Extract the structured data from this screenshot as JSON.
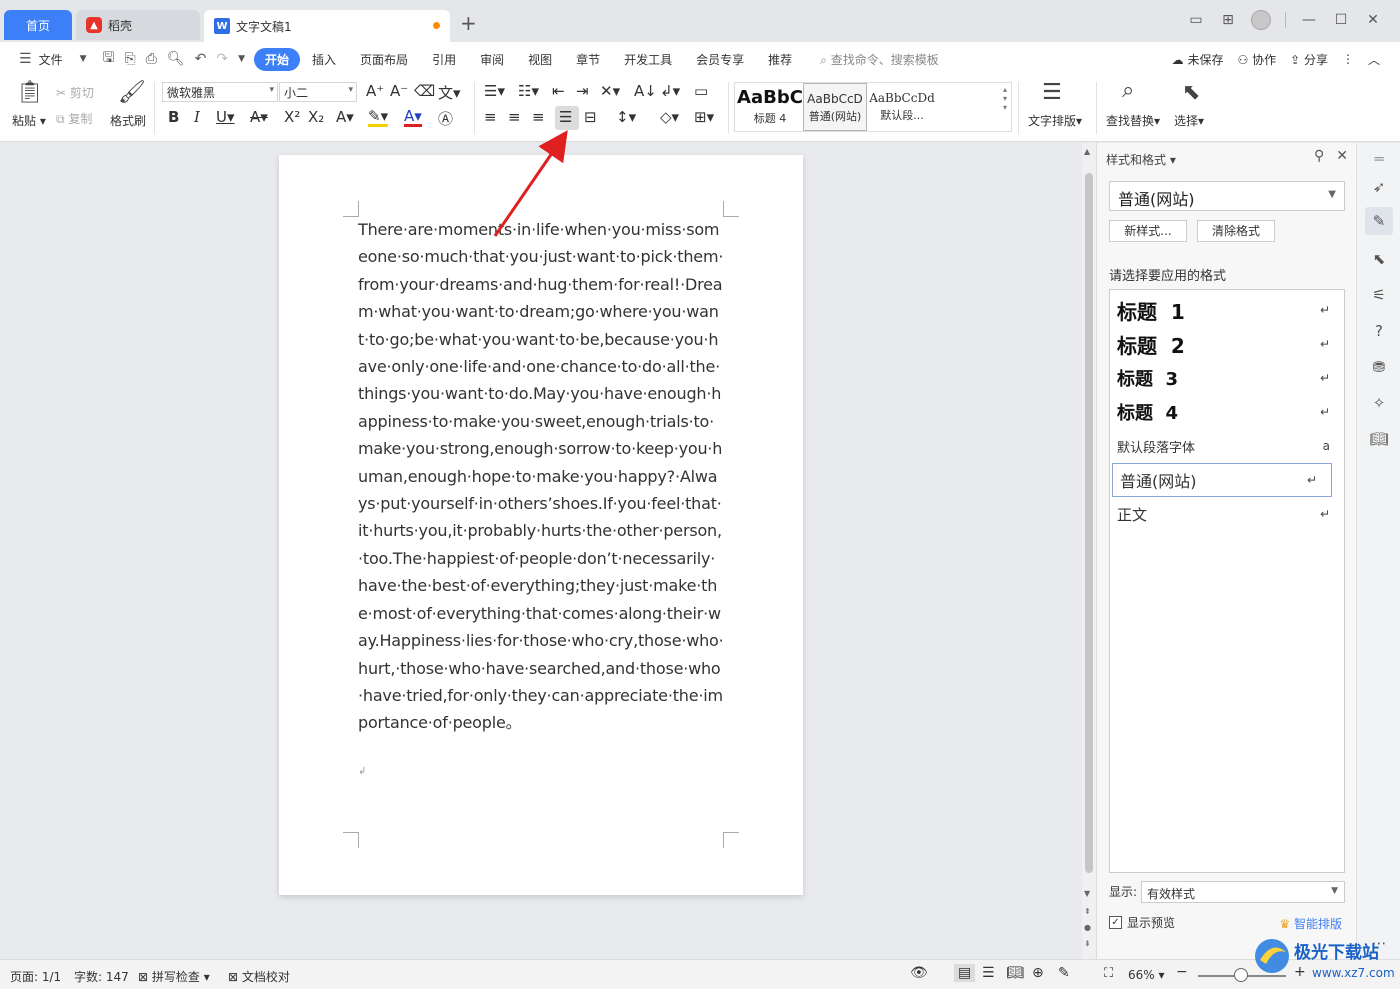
{
  "titlebar": {
    "tab_home": "首页",
    "tab_daoke": "稻壳",
    "tab_doc": "文字文稿1",
    "add_tab": "+",
    "icons": [
      "layout-icon",
      "grid-icon",
      "avatar",
      "minimize-icon",
      "maximize-icon",
      "close-icon"
    ]
  },
  "menu": {
    "file": "文件",
    "items": [
      "开始",
      "插入",
      "页面布局",
      "引用",
      "审阅",
      "视图",
      "章节",
      "开发工具",
      "会员专享",
      "推荐"
    ],
    "active": "开始",
    "search_placeholder": "查找命令、搜索模板",
    "right": {
      "unsaved": "未保存",
      "collab": "协作",
      "share": "分享"
    }
  },
  "ribbon": {
    "paste": "粘贴",
    "cut": "剪切",
    "copy": "复制",
    "format_painter": "格式刷",
    "font_name": "微软雅黑",
    "font_size": "小二",
    "styles": [
      {
        "sample": "AaBbC",
        "name": "标题 4"
      },
      {
        "sample": "AaBbCcD",
        "name": "普通(网站)"
      },
      {
        "sample": "AaBbCcDd",
        "name": "默认段..."
      }
    ],
    "text_layout": "文字排版",
    "find_replace": "查找替换",
    "select": "选择"
  },
  "document": {
    "text": "There·are·moments·in·life·when·you·miss·someone·so·much·that·you·just·want·to·pick·them·from·your·dreams·and·hug·them·for·real!·Dream·what·you·want·to·dream;go·where·you·want·to·go;be·what·you·want·to·be,because·you·have·only·one·life·and·one·chance·to·do·all·the·things·you·want·to·do.May·you·have·enough·happiness·to·make·you·sweet,enough·trials·to·make·you·strong,enough·sorrow·to·keep·you·human,enough·hope·to·make·you·happy?·Always·put·yourself·in·others’shoes.If·you·feel·that·it·hurts·you,it·probably·hurts·the·other·person,·too.The·happiest·of·people·don’t·necessarily·have·the·best·of·everything;they·just·make·the·most·of·everything·that·comes·along·their·way.Happiness·lies·for·those·who·cry,those·who·hurt,·those·who·have·searched,and·those·who·have·tried,for·only·they·can·appreciate·the·importance·of·people。",
    "para_mark": "↲"
  },
  "panel": {
    "title": "样式和格式",
    "current_style": "普通(网站)",
    "new_style_btn": "新样式...",
    "clear_btn": "清除格式",
    "choose_label": "请选择要应用的格式",
    "styles": [
      {
        "label": "标题  1",
        "mark": "↵"
      },
      {
        "label": "标题  2",
        "mark": "↵"
      },
      {
        "label": "标题  3",
        "mark": "↵"
      },
      {
        "label": "标题  4",
        "mark": "↵"
      },
      {
        "label": "默认段落字体",
        "mark": "a"
      },
      {
        "label": "普通(网站)",
        "mark": "↵"
      },
      {
        "label": "正文",
        "mark": "↵"
      }
    ],
    "selected_style": "普通(网站)",
    "show_label": "显示:",
    "show_value": "有效样式",
    "preview_label": "显示预览",
    "preview_checked": true,
    "smart_layout": "智能排版"
  },
  "statusbar": {
    "page": "页面: 1/1",
    "words": "字数: 147",
    "spell": "拼写检查",
    "proofread": "文档校对",
    "zoom": "66%",
    "zoom_level": 0.66
  },
  "watermark": {
    "brand": "极光下载站",
    "url": "www.xz7.com"
  },
  "colors": {
    "accent": "#3d7ff6",
    "annotation_arrow": "#e02020",
    "unsaved_dot": "#ff8a00"
  }
}
